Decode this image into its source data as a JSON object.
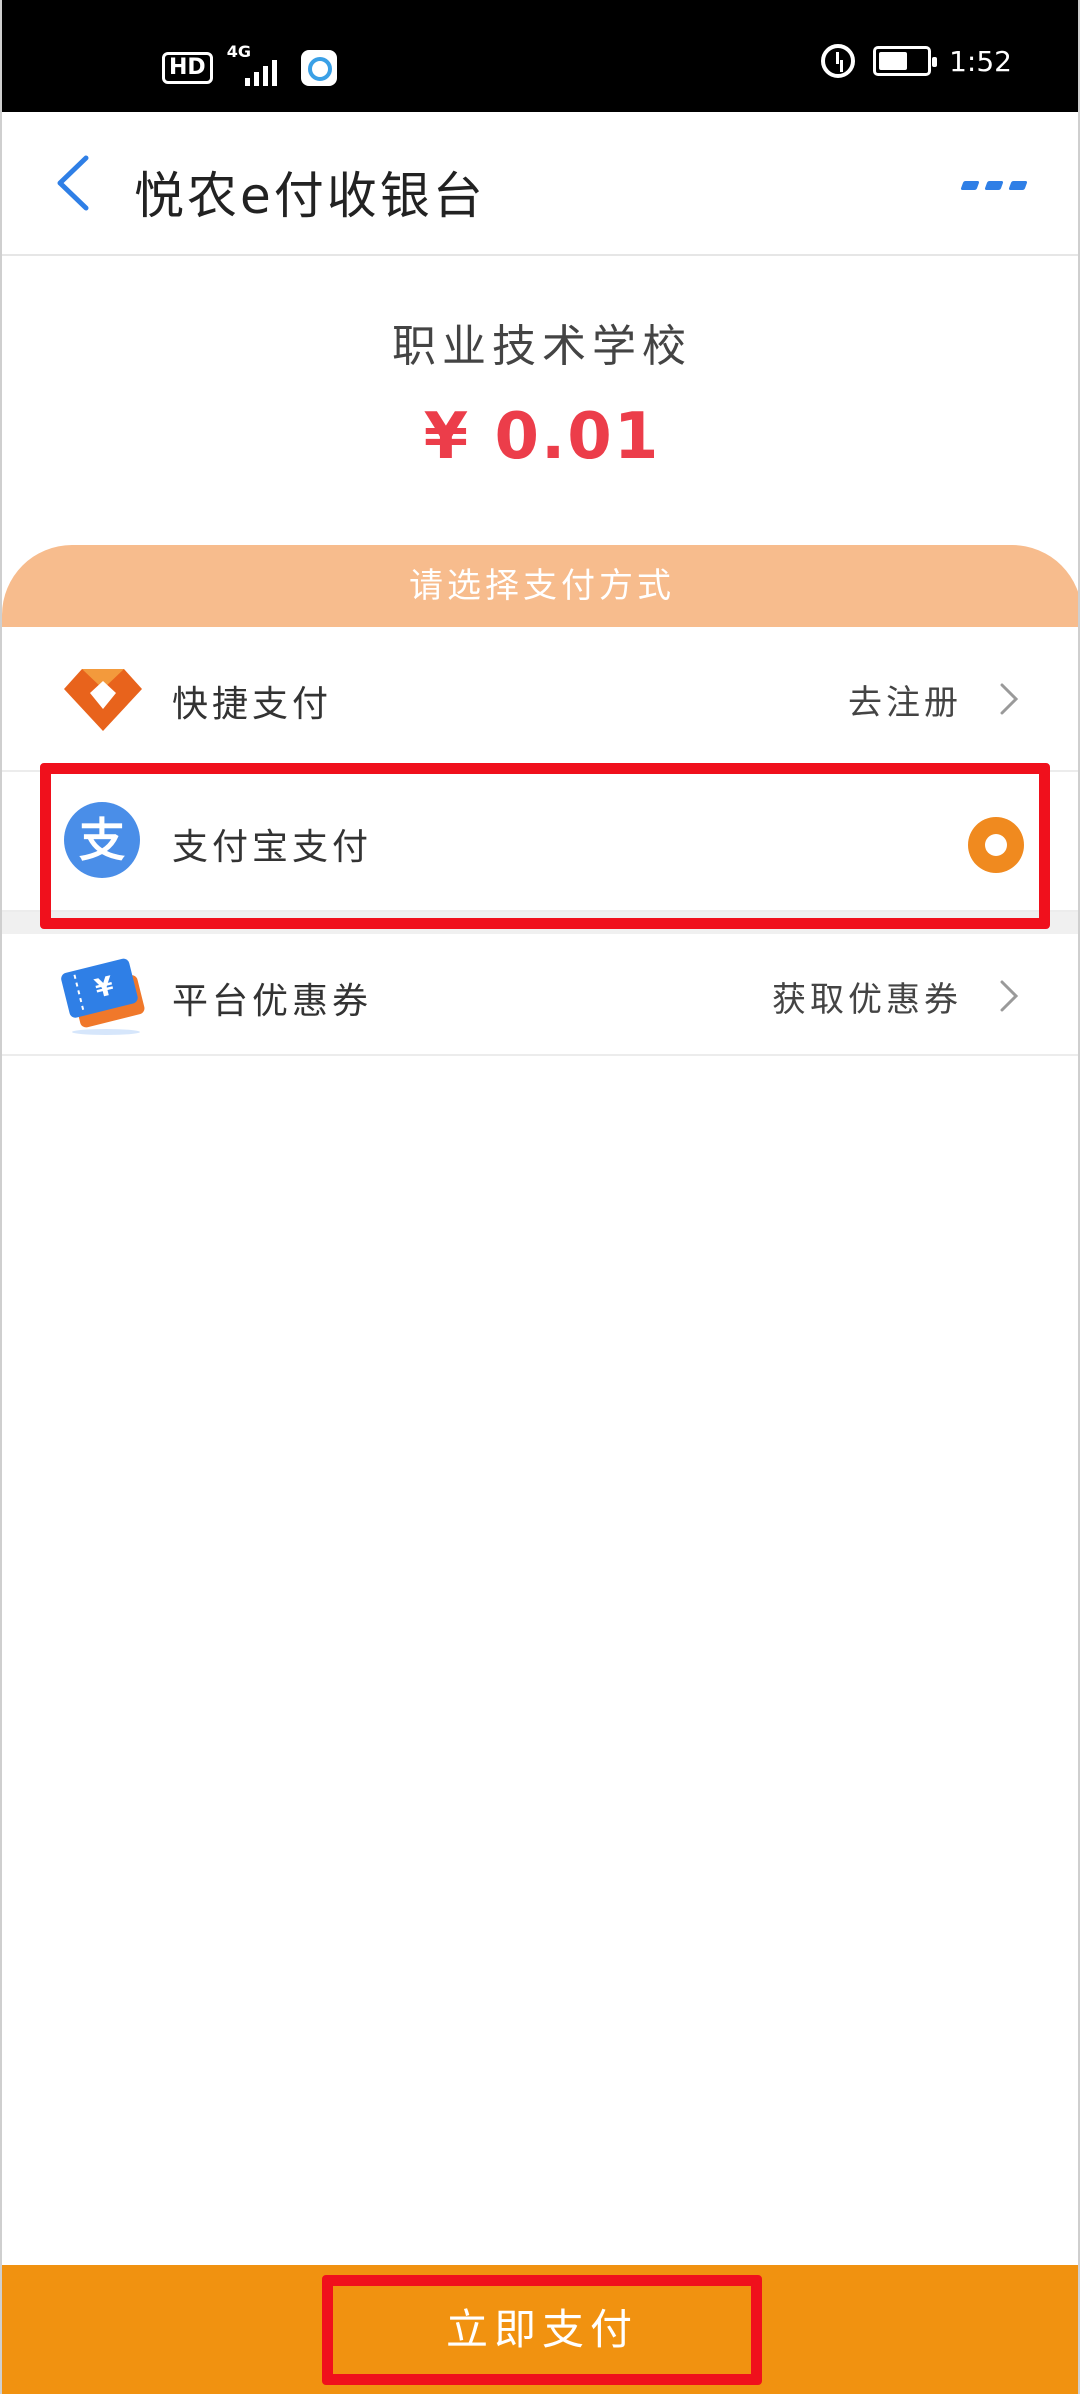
{
  "status_bar": {
    "hd_label": "HD",
    "network_label": "4G",
    "time": "1:52",
    "battery_level": 0.6
  },
  "header": {
    "title": "悦农e付收银台"
  },
  "payment": {
    "merchant": "职业技术学校",
    "amount": "¥ 0.01"
  },
  "methods": {
    "section_title": "请选择支付方式",
    "quick_pay": {
      "label": "快捷支付",
      "action": "去注册"
    },
    "alipay": {
      "label": "支付宝支付",
      "icon_text": "支",
      "selected": true
    },
    "coupon": {
      "label": "平台优惠券",
      "action": "获取优惠券"
    }
  },
  "footer": {
    "pay_label": "立即支付"
  },
  "colors": {
    "accent_orange": "#f19210",
    "section_bg": "#f7bc8d",
    "amount_red": "#ec3d4a",
    "alipay_blue": "#4a8ee8",
    "highlight_red": "#f0101c"
  }
}
